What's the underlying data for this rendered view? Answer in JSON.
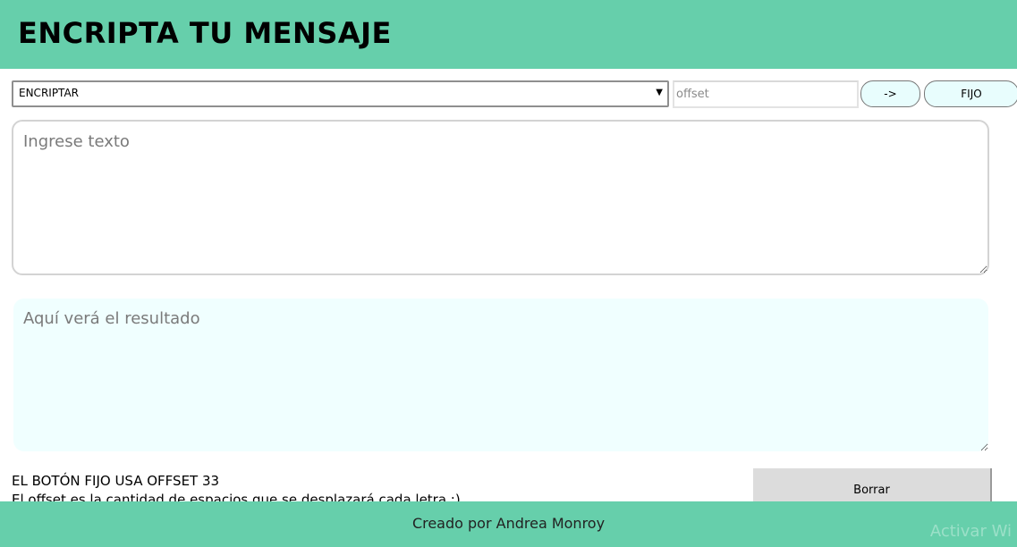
{
  "header": {
    "title": "ENCRIPTA TU MENSAJE"
  },
  "controls": {
    "mode_select": {
      "selected": "ENCRIPTAR"
    },
    "offset_input": {
      "value": "",
      "placeholder": "offset"
    },
    "arrow_button_label": "->",
    "fijo_button_label": "FIJO"
  },
  "input_area": {
    "value": "",
    "placeholder": "Ingrese texto"
  },
  "output_area": {
    "value": "",
    "placeholder": "Aquí verá el resultado"
  },
  "info": {
    "title": "EL BOTÓN FIJO USA OFFSET 33",
    "text": "El offset es la cantidad de espacios que se desplazará cada letra :)"
  },
  "clear_button_label": "Borrar",
  "footer": {
    "credit": "Creado por Andrea Monroy",
    "watermark": "Activar Wi"
  },
  "colors": {
    "brand": "#66cfab",
    "button_bg": "#e8fdfd",
    "output_bg": "#f0ffff"
  }
}
